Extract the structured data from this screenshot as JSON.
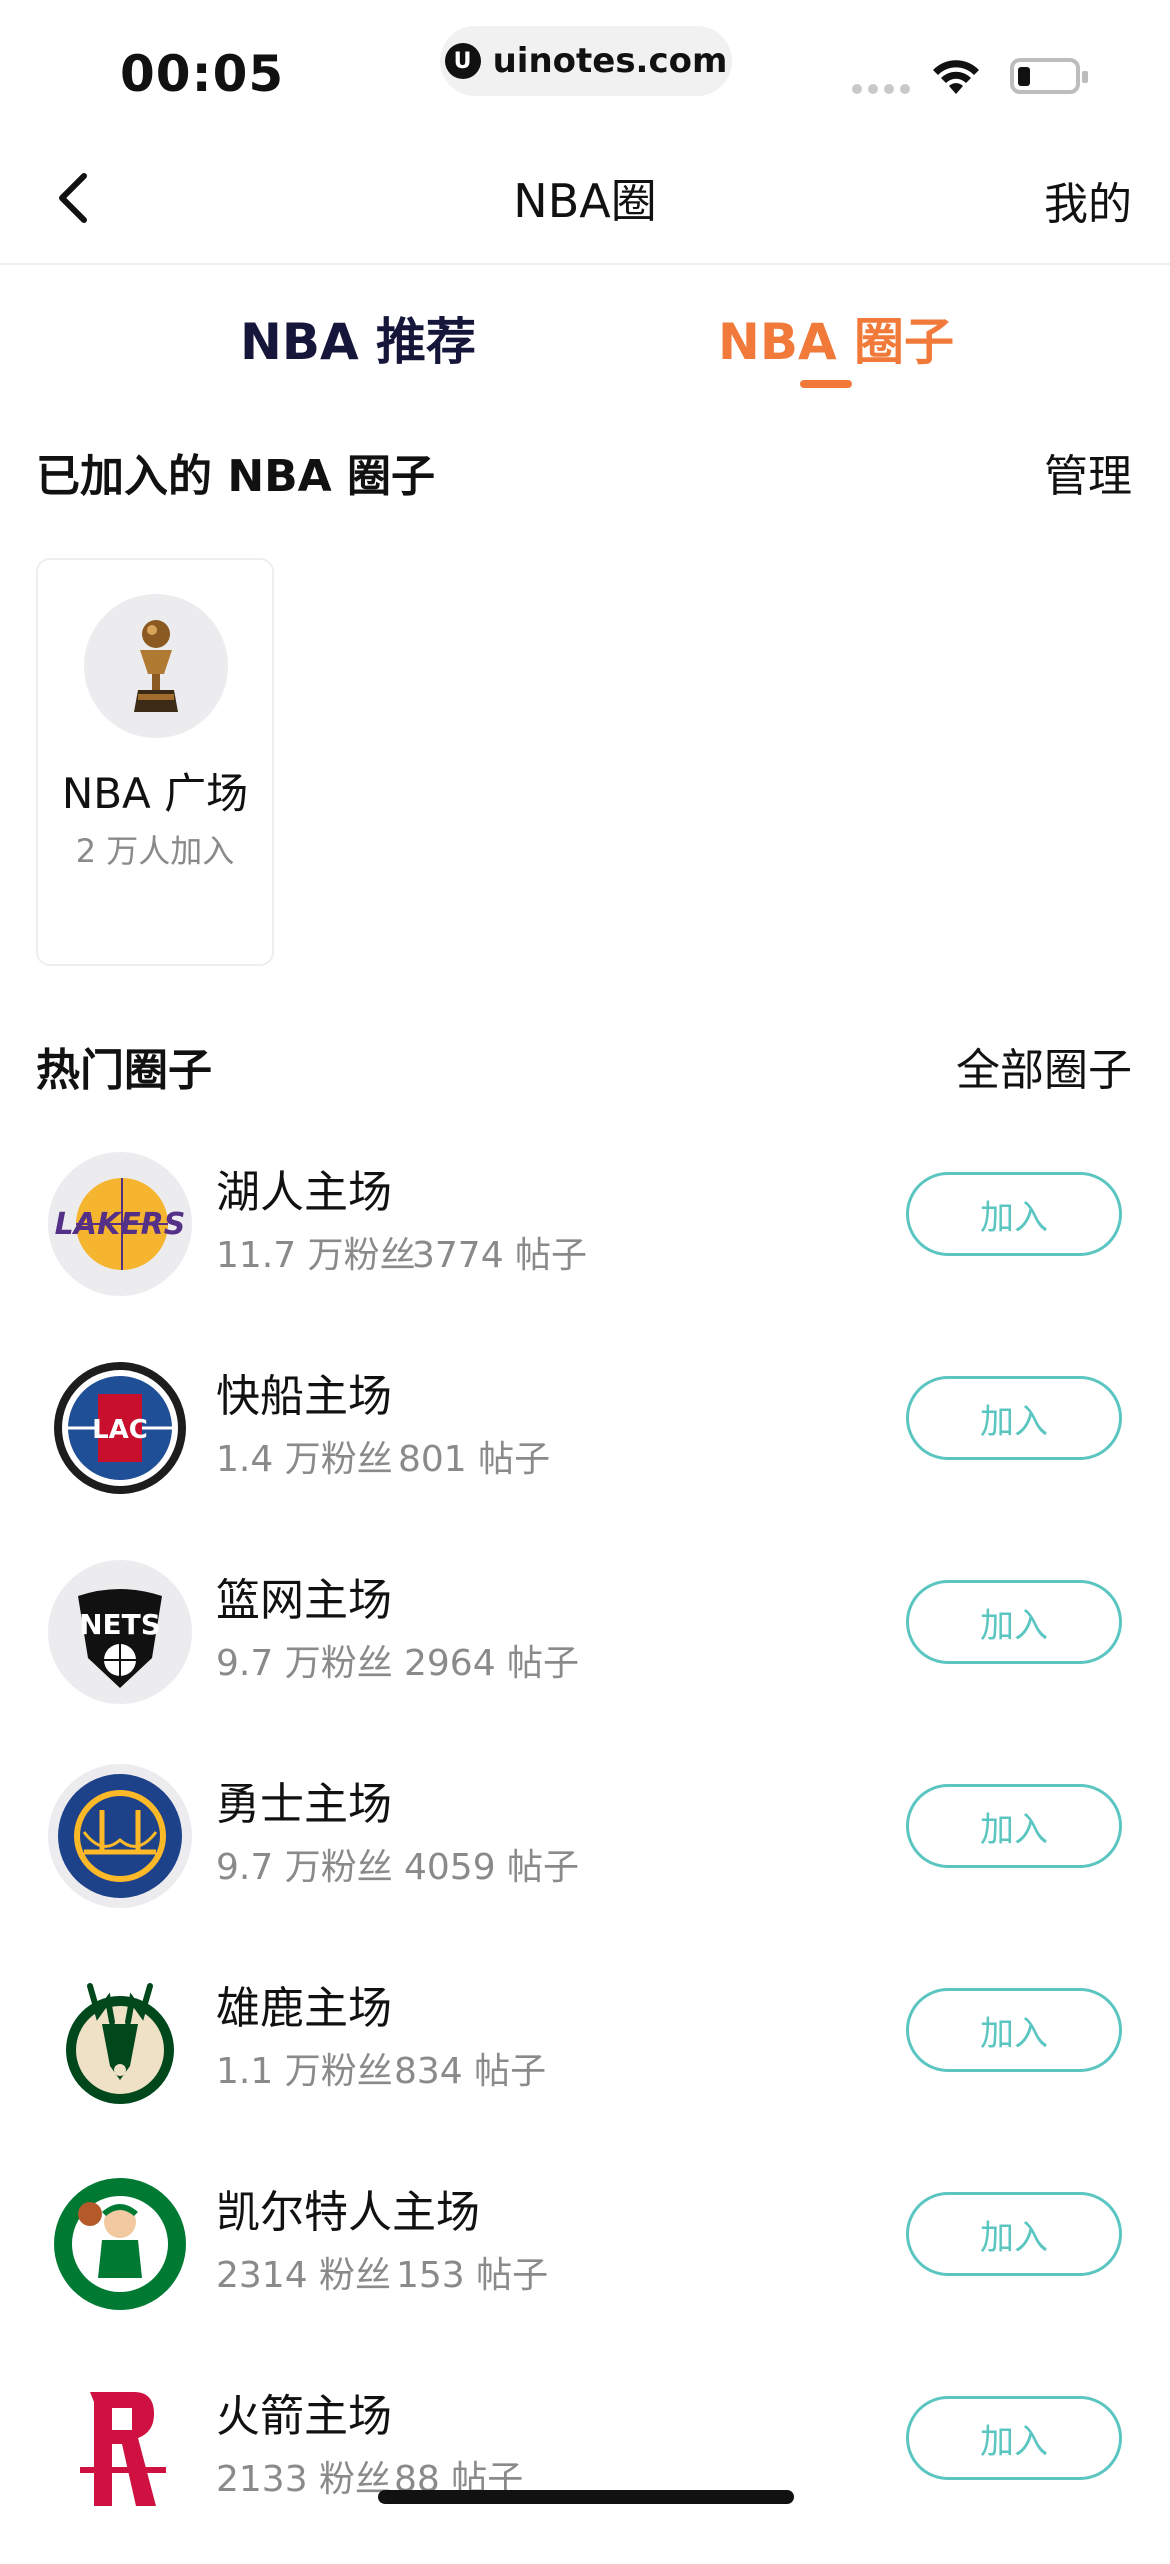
{
  "status": {
    "time": "00:05",
    "url": "uinotes.com",
    "url_logo": "U"
  },
  "nav": {
    "title": "NBA圈",
    "right": "我的"
  },
  "tabs": [
    {
      "label": "NBA 推荐",
      "active": false
    },
    {
      "label": "NBA 圈子",
      "active": true
    }
  ],
  "joined": {
    "title": "已加入的 NBA 圈子",
    "manage": "管理",
    "items": [
      {
        "name": "NBA 广场",
        "sub": "2 万人加入",
        "icon": "trophy-icon"
      }
    ]
  },
  "hot": {
    "title": "热门圈子",
    "all": "全部圈子",
    "join_label": "加入",
    "items": [
      {
        "name": "湖人主场",
        "fans": "11.7 万粉丝",
        "posts": "3774 帖子",
        "logo": "lakers-logo"
      },
      {
        "name": "快船主场",
        "fans": "1.4 万粉丝",
        "posts": "801 帖子",
        "logo": "clippers-logo"
      },
      {
        "name": "篮网主场",
        "fans": "9.7 万粉丝",
        "posts": "2964 帖子",
        "logo": "nets-logo"
      },
      {
        "name": "勇士主场",
        "fans": "9.7 万粉丝",
        "posts": "4059 帖子",
        "logo": "warriors-logo"
      },
      {
        "name": "雄鹿主场",
        "fans": "1.1 万粉丝",
        "posts": "834 帖子",
        "logo": "bucks-logo"
      },
      {
        "name": "凯尔特人主场",
        "fans": "2314 粉丝",
        "posts": "153 帖子",
        "logo": "celtics-logo"
      },
      {
        "name": "火箭主场",
        "fans": "2133 粉丝",
        "posts": "88 帖子",
        "logo": "rockets-logo"
      }
    ]
  },
  "logo_text": {
    "lakers": "LAKERS",
    "nets": "NETS",
    "clippers": "LAC"
  },
  "colors": {
    "accent": "#f17a3a",
    "tab_inactive": "#16153a",
    "join": "#5bc6c1",
    "muted": "#8a8a8a"
  }
}
